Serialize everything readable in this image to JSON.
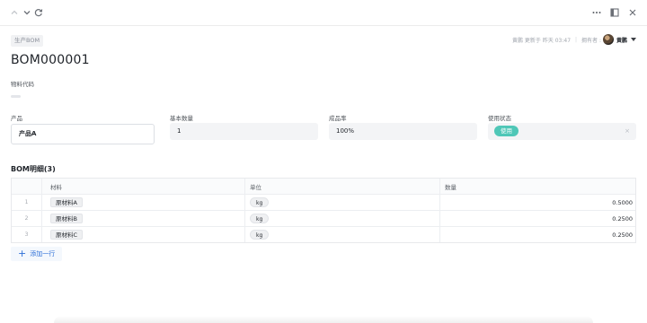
{
  "tag": "生产BOM",
  "meta": {
    "updated_by": "黄鹏 更新于 昨天 03:47",
    "owner_label": "拥有者 :",
    "owner_name": "黄鹏"
  },
  "title": "BOM000001",
  "material_code": {
    "label": "物料代码"
  },
  "fields": {
    "product": {
      "label": "产品",
      "value": "产品A"
    },
    "base_qty": {
      "label": "基本数量",
      "value": "1"
    },
    "yield": {
      "label": "成品率",
      "value": "100%"
    },
    "status": {
      "label": "使用状态",
      "value": "使用"
    }
  },
  "detail": {
    "title": "BOM明细(3)",
    "columns": [
      "材料",
      "单位",
      "数量"
    ],
    "rows": [
      {
        "idx": "1",
        "material": "原材料A",
        "unit": "kg",
        "qty": "0.5000"
      },
      {
        "idx": "2",
        "material": "原材料B",
        "unit": "kg",
        "qty": "0.2500"
      },
      {
        "idx": "3",
        "material": "原材料C",
        "unit": "kg",
        "qty": "0.2500"
      }
    ],
    "add_row": "添加一行"
  },
  "colors": {
    "accent": "#2d6fd8",
    "status_green": "#4fc7b7"
  },
  "icons": [
    "chevron-up-icon",
    "chevron-down-icon",
    "refresh-icon",
    "more-icon",
    "panel-icon",
    "close-icon"
  ]
}
